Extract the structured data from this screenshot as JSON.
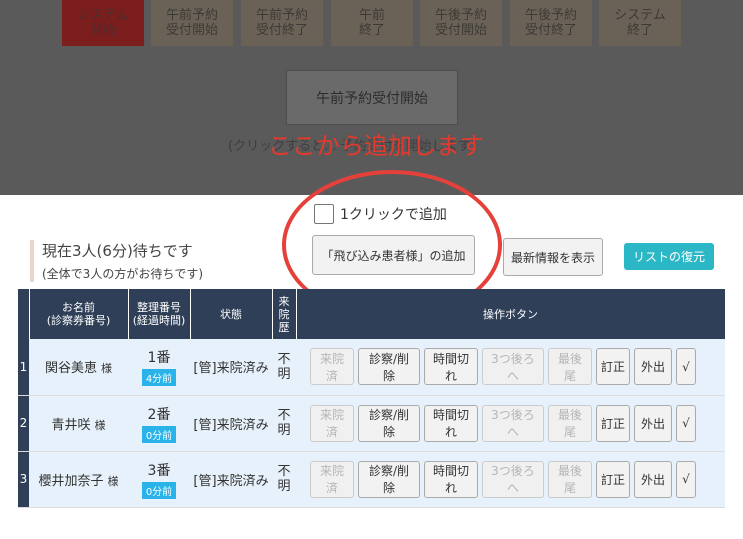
{
  "phases": [
    {
      "label": "システム\n開始",
      "active": true
    },
    {
      "label": "午前予約\n受付開始",
      "active": false
    },
    {
      "label": "午前予約\n受付終了",
      "active": false
    },
    {
      "label": "午前\n終了",
      "active": false
    },
    {
      "label": "午後予約\n受付開始",
      "active": false
    },
    {
      "label": "午後予約\n受付終了",
      "active": false
    },
    {
      "label": "システム\n終了",
      "active": false
    }
  ],
  "am_start_button": "午前予約受付開始",
  "hint": "(クリックすると... 予約受付を開始します)",
  "callout": "ここから追加します",
  "one_click_label": "1クリックで追加",
  "status": {
    "main": "現在3人(6分)待ちです",
    "sub": "(全体で3人の方がお待ちです)"
  },
  "buttons": {
    "add_walkin": "「飛び込み患者様」の追加",
    "refresh": "最新情報を表示",
    "restore": "リストの復元"
  },
  "table": {
    "headers": {
      "name": "お名前",
      "name_sub": "(診察券番号)",
      "ticket": "整理番号",
      "ticket_sub": "(経過時間)",
      "state": "状態",
      "visited": "来\n院\n歴",
      "ops": "操作ボタン"
    },
    "rows": [
      {
        "num": "1",
        "name": "関谷美恵",
        "sama": "様",
        "ticket": "1番",
        "elapsed": "4分前",
        "state": "[管]来院済み",
        "visited": "不\n明"
      },
      {
        "num": "2",
        "name": "青井咲",
        "sama": "様",
        "ticket": "2番",
        "elapsed": "0分前",
        "state": "[管]来院済み",
        "visited": "不\n明"
      },
      {
        "num": "3",
        "name": "櫻井加奈子",
        "sama": "様",
        "ticket": "3番",
        "elapsed": "0分前",
        "state": "[管]来院済み",
        "visited": "不\n明"
      }
    ],
    "op_buttons": [
      {
        "label": "来院済",
        "disabled": true
      },
      {
        "label": "診察/削除",
        "disabled": false
      },
      {
        "label": "時間切れ",
        "disabled": false
      },
      {
        "label": "3つ後ろへ",
        "disabled": true
      },
      {
        "label": "最後尾",
        "disabled": true
      },
      {
        "label": "訂正",
        "disabled": false
      },
      {
        "label": "外出",
        "disabled": false
      },
      {
        "label": "√",
        "disabled": false
      }
    ]
  },
  "colors": {
    "overlay": "#5a5a5a",
    "header_navy": "#2f3f57",
    "accent_cyan": "#2bb7c5",
    "elapsed_blue": "#29b3e8",
    "callout_red": "#e33a2f"
  }
}
